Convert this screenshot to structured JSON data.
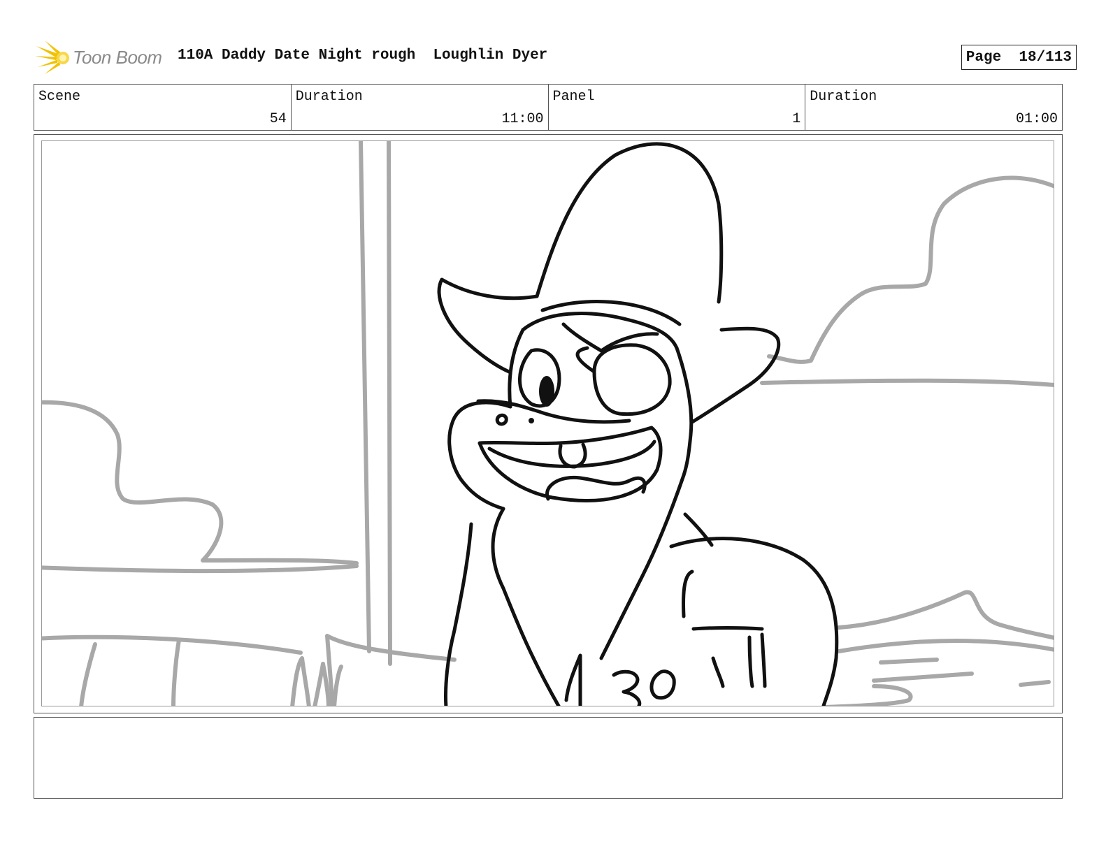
{
  "header": {
    "logo_text": "Toon Boom",
    "logo_icon": "toon-boom-burst-icon",
    "title": "110A Daddy Date Night rough  Loughlin Dyer",
    "page_label": "Page  18/113"
  },
  "info": {
    "scene_label": "Scene",
    "scene_value": "54",
    "scene_duration_label": "Duration",
    "scene_duration_value": "11:00",
    "panel_label": "Panel",
    "panel_value": "1",
    "panel_duration_label": "Duration",
    "panel_duration_value": "01:00"
  },
  "drawing": {
    "shirt_text": "30",
    "colors": {
      "ink": "#111111",
      "background_lines": "#a8a8a8",
      "logo_yellow": "#f2c200"
    }
  },
  "notes": {
    "text": ""
  }
}
